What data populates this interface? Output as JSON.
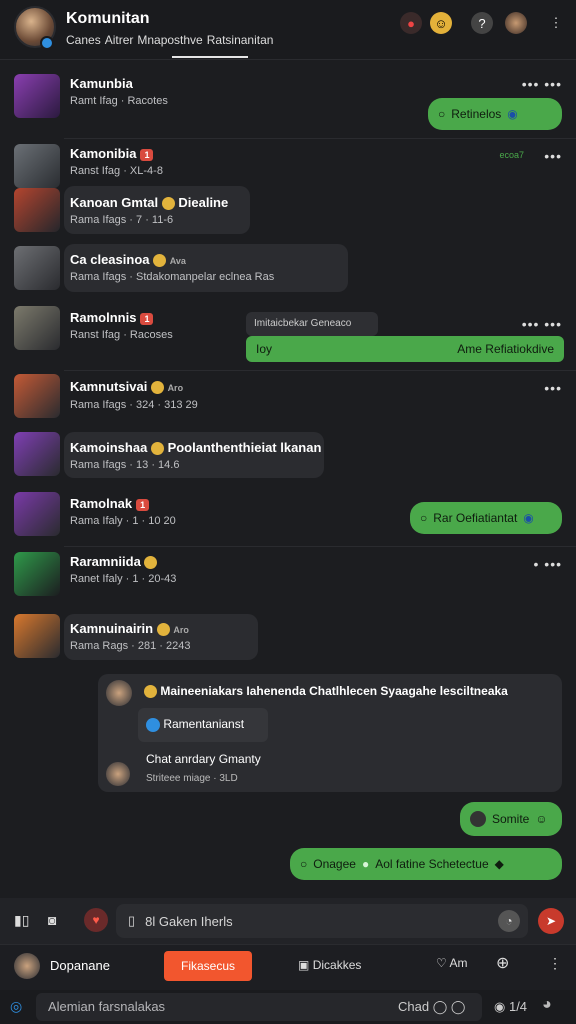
{
  "header": {
    "title": "Komunitan",
    "tabs": [
      "Canes",
      "Aitrer",
      "Mnaposthve",
      "Ratsinanitan"
    ],
    "icons": [
      "alert-icon",
      "emoji-icon",
      "help-icon",
      "user-avatar",
      "more-icon"
    ]
  },
  "messages": [
    {
      "name": "Kamunbia",
      "pill": "",
      "sub": "Ramt Ifag · Racotes",
      "bubble": "Retinelos"
    },
    {
      "name": "Kamonibia",
      "pill": "",
      "sub": "Ranst Ifag · XL-4-8",
      "right_label": "ecoa7"
    },
    {
      "name": "Kanoan Gmtal",
      "extra": "Diealine",
      "sub": "Rama Ifags · 7 · 11-6"
    },
    {
      "name": "Ca cleasinoa",
      "extra": "Ava",
      "sub": "Rama Ifags · Stdakomanpelar eclnea Ras"
    },
    {
      "name": "Ramolnnis",
      "pill": "",
      "sub": "Ranst Ifag · Racoses",
      "card_head": "Imitaicbekar Geneaco",
      "bubble_left": "Ioy",
      "bubble_right": "Ame Refiatiokdive"
    },
    {
      "name": "Kamnutsivai",
      "extra": "Aro",
      "sub": "Rama Ifags · 324 · 313 29"
    },
    {
      "name": "Kamoinshaa",
      "extra": "Poolanthenthieiat lkanan",
      "sub": "Rama Ifags · 13 · 14.6"
    },
    {
      "name": "Ramolnak",
      "pill": "",
      "sub": "Rama Ifaly · 1 · 10 20",
      "bubble": "Rar Oefiatiantat"
    },
    {
      "name": "Raramniida",
      "sub": "Ranet Ifaly · 1 · 20-43"
    },
    {
      "name": "Kamnuinairin",
      "extra": "Aro",
      "sub": "Rama Rags · 281 · 2243"
    }
  ],
  "thread": {
    "header": "Maineeniakars Iahenenda Chatlhlecen Syaagahe lesciltneaka",
    "quote": "Ramentanianst",
    "body": "Chat anrdary Gmanty",
    "meta": "Striteee miage · 3LD"
  },
  "bubbles": {
    "send1": "Somite",
    "send2_left": "Onagee",
    "send2_right": "Aol fatine Schetectue"
  },
  "input": {
    "value": "8l Gaken Iherls"
  },
  "nav": {
    "user": "Dopanane",
    "active": "Fikasecus",
    "item2": "Dicakkes",
    "item3": "Am"
  },
  "bottom": {
    "placeholder": "Alemian farsnalakas",
    "right": "Chad",
    "count": "1/4"
  }
}
